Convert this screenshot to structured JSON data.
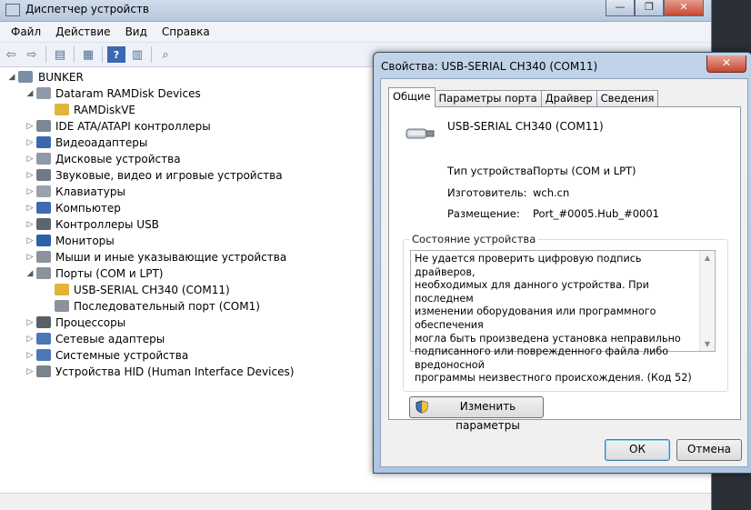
{
  "device_manager": {
    "title": "Диспетчер устройств",
    "window_buttons": [
      "—",
      "❐",
      "✕"
    ],
    "menu": [
      "Файл",
      "Действие",
      "Вид",
      "Справка"
    ],
    "tree": [
      {
        "label": "BUNKER",
        "level": 0,
        "expander": "◢",
        "icon": "computer-icon",
        "color": "#7a8ea8"
      },
      {
        "label": "Dataram RAMDisk Devices",
        "level": 1,
        "expander": "◢",
        "icon": "disk-icon",
        "color": "#8f9aa8"
      },
      {
        "label": "RAMDiskVE",
        "level": 2,
        "expander": "",
        "icon": "warning-disk-icon",
        "color": "#e2b53a"
      },
      {
        "label": "IDE ATA/ATAPI контроллеры",
        "level": 1,
        "expander": "▷",
        "icon": "ide-controller-icon",
        "color": "#7d8896"
      },
      {
        "label": "Видеоадаптеры",
        "level": 1,
        "expander": "▷",
        "icon": "display-adapter-icon",
        "color": "#3b67b0"
      },
      {
        "label": "Дисковые устройства",
        "level": 1,
        "expander": "▷",
        "icon": "disk-drive-icon",
        "color": "#8f9aa8"
      },
      {
        "label": "Звуковые, видео и игровые устройства",
        "level": 1,
        "expander": "▷",
        "icon": "sound-icon",
        "color": "#6f7a86"
      },
      {
        "label": "Клавиатуры",
        "level": 1,
        "expander": "▷",
        "icon": "keyboard-icon",
        "color": "#9aa3ad"
      },
      {
        "label": "Компьютер",
        "level": 1,
        "expander": "▷",
        "icon": "computer-icon",
        "color": "#3e6bb3"
      },
      {
        "label": "Контроллеры USB",
        "level": 1,
        "expander": "▷",
        "icon": "usb-icon",
        "color": "#5c6470"
      },
      {
        "label": "Мониторы",
        "level": 1,
        "expander": "▷",
        "icon": "monitor-icon",
        "color": "#2f5fa8"
      },
      {
        "label": "Мыши и иные указывающие устройства",
        "level": 1,
        "expander": "▷",
        "icon": "mouse-icon",
        "color": "#8a929c"
      },
      {
        "label": "Порты (COM и LPT)",
        "level": 1,
        "expander": "◢",
        "icon": "port-icon",
        "color": "#8a929c"
      },
      {
        "label": "USB-SERIAL CH340 (COM11)",
        "level": 2,
        "expander": "",
        "icon": "warning-port-icon",
        "color": "#e2b53a"
      },
      {
        "label": "Последовательный порт (COM1)",
        "level": 2,
        "expander": "",
        "icon": "port-icon",
        "color": "#8a929c"
      },
      {
        "label": "Процессоры",
        "level": 1,
        "expander": "▷",
        "icon": "processor-icon",
        "color": "#5a5f66"
      },
      {
        "label": "Сетевые адаптеры",
        "level": 1,
        "expander": "▷",
        "icon": "network-adapter-icon",
        "color": "#4a78b8"
      },
      {
        "label": "Системные устройства",
        "level": 1,
        "expander": "▷",
        "icon": "system-device-icon",
        "color": "#4a78b8"
      },
      {
        "label": "Устройства HID (Human Interface Devices)",
        "level": 1,
        "expander": "▷",
        "icon": "hid-icon",
        "color": "#7a828c"
      }
    ]
  },
  "dialog": {
    "title": "Свойства: USB-SERIAL CH340 (COM11)",
    "close_label": "✕",
    "tabs": [
      "Общие",
      "Параметры порта",
      "Драйвер",
      "Сведения"
    ],
    "active_tab": "Общие",
    "device_name": "USB-SERIAL CH340 (COM11)",
    "properties": [
      {
        "label": "Тип устройства:",
        "value": "Порты (COM и LPT)"
      },
      {
        "label": "Изготовитель:",
        "value": "wch.cn"
      },
      {
        "label": "Размещение:",
        "value": "Port_#0005.Hub_#0001"
      }
    ],
    "status_group_label": "Состояние устройства",
    "status_text": "Не удается проверить цифровую подпись драйверов,\nнеобходимых для данного устройства. При последнем\nизменении оборудования или программного обеспечения\nмогла быть произведена установка неправильно\nподписанного или поврежденного файла либо вредоносной\nпрограммы неизвестного происхождения. (Код 52)",
    "change_settings_label": "Изменить параметры",
    "ok_label": "ОК",
    "cancel_label": "Отмена"
  }
}
